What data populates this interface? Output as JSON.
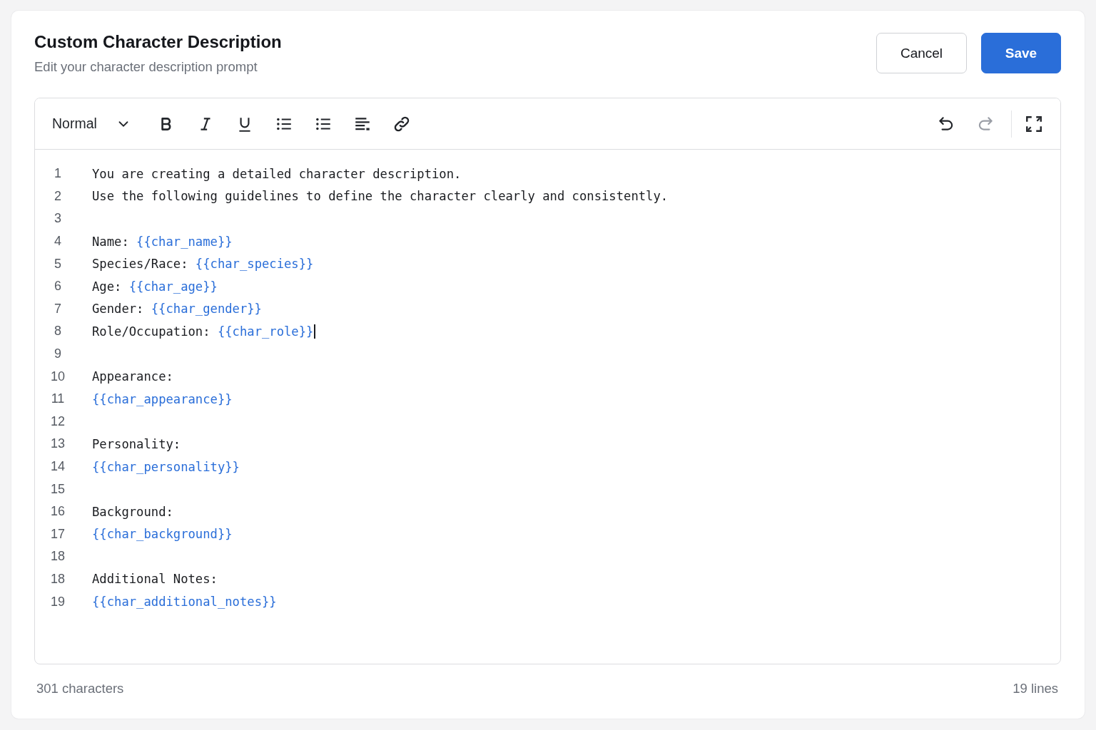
{
  "header": {
    "title": "Custom Character Description",
    "subtitle": "Edit your character description prompt"
  },
  "actions": [
    {
      "label": "Cancel",
      "kind": "secondary"
    },
    {
      "label": "Save",
      "kind": "primary"
    }
  ],
  "toolbar": {
    "format": "Normal",
    "tools": [
      {
        "kind": "bold",
        "disabled": false
      },
      {
        "kind": "italic",
        "disabled": false
      },
      {
        "kind": "underline",
        "disabled": false
      },
      {
        "kind": "bullet-list",
        "disabled": false
      },
      {
        "kind": "bullet-list",
        "disabled": false
      },
      {
        "kind": "align",
        "disabled": false
      },
      {
        "kind": "link",
        "disabled": false
      }
    ],
    "history": [
      {
        "kind": "undo",
        "disabled": false
      },
      {
        "kind": "redo",
        "disabled": true
      }
    ],
    "view": [
      {
        "kind": "fullscreen",
        "disabled": false
      }
    ]
  },
  "lines": [
    {
      "number": "1",
      "cursor": false,
      "segments": [
        {
          "kind": "text",
          "text": "You are creating a detailed character description."
        }
      ]
    },
    {
      "number": "2",
      "cursor": false,
      "segments": [
        {
          "kind": "text",
          "text": "Use the following guidelines to define the character clearly and consistently."
        }
      ]
    },
    {
      "number": "3",
      "cursor": false
    },
    {
      "number": "4",
      "cursor": false,
      "segments": [
        {
          "kind": "text",
          "text": "Name:"
        },
        {
          "kind": "variable",
          "text": "{{char_name}}"
        }
      ]
    },
    {
      "number": "5",
      "cursor": false,
      "segments": [
        {
          "kind": "text",
          "text": "Species/Race:"
        },
        {
          "kind": "variable",
          "text": "{{char_species}}"
        }
      ]
    },
    {
      "number": "6",
      "cursor": false,
      "segments": [
        {
          "kind": "text",
          "text": "Age:"
        },
        {
          "kind": "variable",
          "text": "{{char_age}}"
        }
      ]
    },
    {
      "number": "7",
      "cursor": false,
      "segments": [
        {
          "kind": "text",
          "text": "Gender:"
        },
        {
          "kind": "variable",
          "text": "{{char_gender}}"
        }
      ]
    },
    {
      "number": "8",
      "cursor": true,
      "segments": [
        {
          "kind": "text",
          "text": "Role/Occupation:"
        },
        {
          "kind": "variable",
          "text": "{{char_role}}"
        }
      ]
    },
    {
      "number": "9",
      "cursor": false
    },
    {
      "number": "10",
      "cursor": false,
      "segments": [
        {
          "kind": "text",
          "text": "Appearance:"
        }
      ]
    },
    {
      "number": "11",
      "cursor": false,
      "segments": [
        {
          "kind": "variable",
          "text": "{{char_appearance}}"
        }
      ]
    },
    {
      "number": "12",
      "cursor": false
    },
    {
      "number": "13",
      "cursor": false,
      "segments": [
        {
          "kind": "text",
          "text": "Personality:"
        }
      ]
    },
    {
      "number": "14",
      "cursor": false,
      "segments": [
        {
          "kind": "variable",
          "text": "{{char_personality}}"
        }
      ]
    },
    {
      "number": "15",
      "cursor": false
    },
    {
      "number": "16",
      "cursor": false,
      "segments": [
        {
          "kind": "text",
          "text": "Background:"
        }
      ]
    },
    {
      "number": "17",
      "cursor": false,
      "segments": [
        {
          "kind": "variable",
          "text": "{{char_background}}"
        }
      ]
    },
    {
      "number": "18",
      "cursor": false
    },
    {
      "number": "18",
      "cursor": false,
      "segments": [
        {
          "kind": "text",
          "text": "Additional Notes:"
        }
      ]
    },
    {
      "number": "19",
      "cursor": false,
      "segments": [
        {
          "kind": "variable",
          "text": "{{char_additional_notes}}"
        }
      ]
    }
  ],
  "footer": {
    "characters": "301 characters",
    "lines": "19 lines"
  }
}
